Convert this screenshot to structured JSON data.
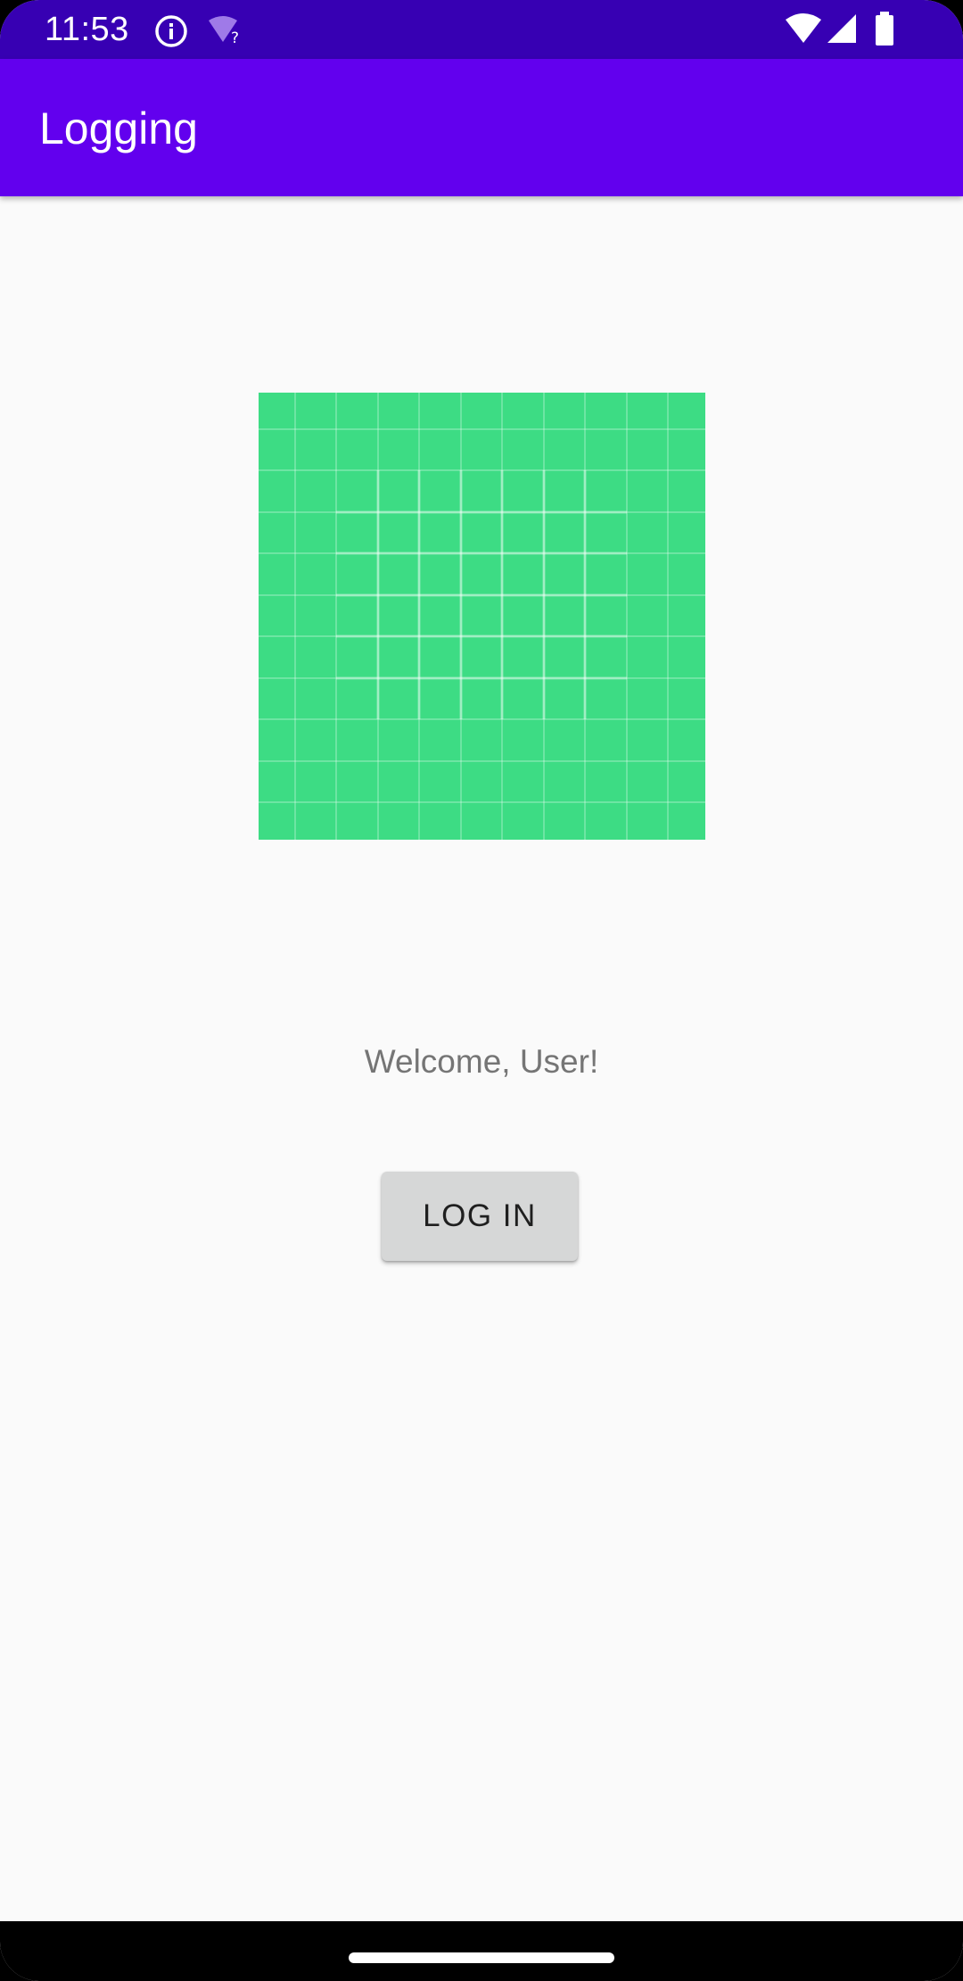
{
  "status_bar": {
    "time": "11:53",
    "icons": [
      "info-icon",
      "wifi-unknown-icon",
      "wifi-icon",
      "cell-signal-icon",
      "battery-icon"
    ]
  },
  "app_bar": {
    "title": "Logging"
  },
  "main": {
    "image_icon": "green-grid-image",
    "welcome_text": "Welcome, User!",
    "login_button_label": "LOG IN"
  },
  "colors": {
    "status_bar": "#3700b3",
    "app_bar": "#6200ee",
    "background": "#fafafa",
    "image_fill": "#3ddc84",
    "button_fill": "#d6d7d7",
    "welcome_text": "#757575"
  }
}
